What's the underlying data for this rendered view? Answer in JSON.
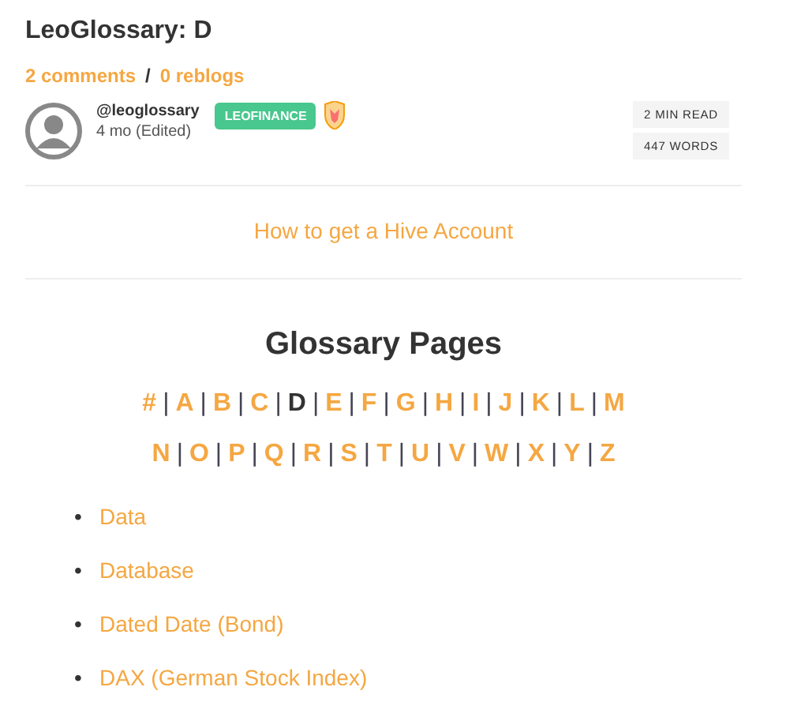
{
  "title": "LeoGlossary: D",
  "stats": {
    "comments": "2 comments",
    "separator": "/",
    "reblogs": "0 reblogs"
  },
  "author": {
    "name": "@leoglossary",
    "time": "4 mo (Edited)",
    "community": "LEOFINANCE"
  },
  "meta": [
    "2 MIN READ",
    "447 WORDS"
  ],
  "link": "How to get a Hive Account",
  "glossary": {
    "heading": "Glossary Pages",
    "separator": "|",
    "lines": [
      {
        "letters": [
          {
            "label": "#",
            "selected": false
          },
          {
            "label": "A",
            "selected": false
          },
          {
            "label": "B",
            "selected": false
          },
          {
            "label": "C",
            "selected": false
          },
          {
            "label": "D",
            "selected": true
          },
          {
            "label": "E",
            "selected": false
          },
          {
            "label": "F",
            "selected": false
          },
          {
            "label": "G",
            "selected": false
          },
          {
            "label": "H",
            "selected": false
          },
          {
            "label": "I",
            "selected": false
          },
          {
            "label": "J",
            "selected": false
          },
          {
            "label": "K",
            "selected": false
          },
          {
            "label": "L",
            "selected": false
          },
          {
            "label": "M",
            "selected": false
          }
        ]
      },
      {
        "letters": [
          {
            "label": "N",
            "selected": false
          },
          {
            "label": "O",
            "selected": false
          },
          {
            "label": "P",
            "selected": false
          },
          {
            "label": "Q",
            "selected": false
          },
          {
            "label": "R",
            "selected": false
          },
          {
            "label": "S",
            "selected": false
          },
          {
            "label": "T",
            "selected": false
          },
          {
            "label": "U",
            "selected": false
          },
          {
            "label": "V",
            "selected": false
          },
          {
            "label": "W",
            "selected": false
          },
          {
            "label": "X",
            "selected": false
          },
          {
            "label": "Y",
            "selected": false
          },
          {
            "label": "Z",
            "selected": false
          }
        ]
      }
    ]
  },
  "bullet": "•",
  "terms": [
    "Data",
    "Database",
    "Dated Date (Bond)",
    "DAX (German Stock Index)"
  ]
}
